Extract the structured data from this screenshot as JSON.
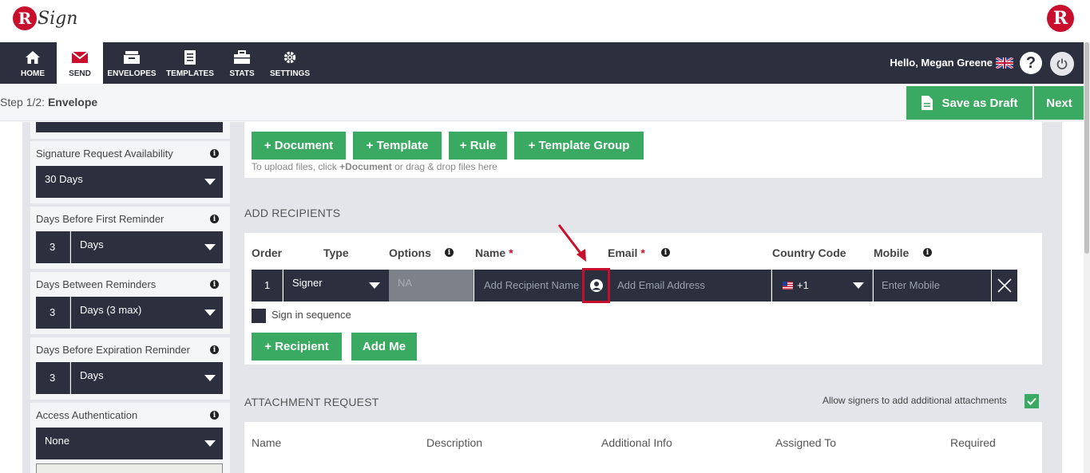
{
  "app": {
    "logo_text": "Sign",
    "logo_letter": "R",
    "brand_color": "#c8102e",
    "nav_color": "#2b2f3e",
    "accent_green": "#3aaa62"
  },
  "nav": {
    "items": [
      {
        "label": "HOME",
        "icon": "home-icon"
      },
      {
        "label": "SEND",
        "icon": "envelope-icon"
      },
      {
        "label": "ENVELOPES",
        "icon": "inbox-icon"
      },
      {
        "label": "TEMPLATES",
        "icon": "templates-icon"
      },
      {
        "label": "STATS",
        "icon": "briefcase-icon"
      },
      {
        "label": "SETTINGS",
        "icon": "gear-icon"
      }
    ],
    "active": "SEND",
    "greeting": "Hello, Megan Greene"
  },
  "stepbar": {
    "step_prefix": "Step 1/2:",
    "step_name": "Envelope",
    "save_draft_label": "Save as Draft",
    "next_label": "Next"
  },
  "sidebar": {
    "sig_avail": {
      "label": "Signature Request Availability",
      "value": "30 Days"
    },
    "first_reminder": {
      "label": "Days Before First Reminder",
      "number": "3",
      "unit": "Days"
    },
    "between_reminders": {
      "label": "Days Between Reminders",
      "number": "3",
      "unit": "Days (3 max)"
    },
    "expiration_reminder": {
      "label": "Days Before Expiration Reminder",
      "number": "3",
      "unit": "Days"
    },
    "access_auth": {
      "label": "Access Authentication",
      "value": "None"
    }
  },
  "documents": {
    "buttons": [
      "+ Document",
      "+ Template",
      "+ Rule",
      "+ Template Group"
    ],
    "hint_pre": "To upload files, click ",
    "hint_bold": "+Document",
    "hint_post": " or drag & drop files here"
  },
  "recipients": {
    "title": "ADD RECIPIENTS",
    "headers": {
      "order": "Order",
      "type": "Type",
      "options": "Options",
      "name": "Name",
      "email": "Email",
      "country_code": "Country Code",
      "mobile": "Mobile"
    },
    "required_mark": "*",
    "row": {
      "order": "1",
      "type": "Signer",
      "options": "NA",
      "name_placeholder": "Add Recipient Name",
      "email_placeholder": "Add Email Address",
      "country_code": "+1",
      "mobile_placeholder": "Enter Mobile"
    },
    "sign_in_sequence": "Sign in sequence",
    "add_recipient_label": "+ Recipient",
    "add_me_label": "Add Me"
  },
  "attachments": {
    "title": "ATTACHMENT REQUEST",
    "allow_label": "Allow signers to add additional attachments",
    "headers": [
      "Name",
      "Description",
      "Additional Info",
      "Assigned To",
      "Required"
    ]
  }
}
